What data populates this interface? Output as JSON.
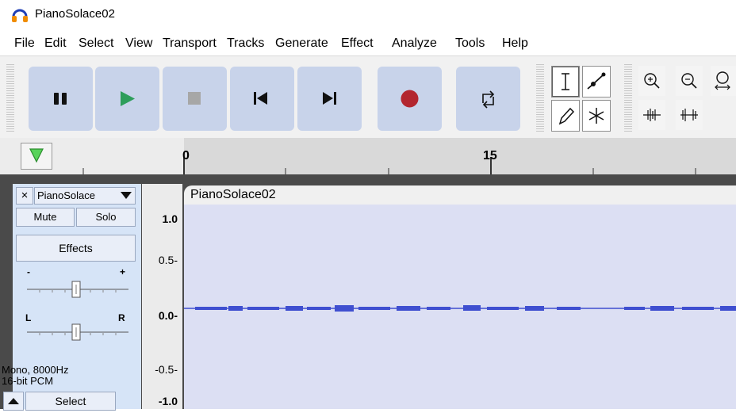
{
  "window": {
    "title": "PianoSolace02"
  },
  "menu": [
    "File",
    "Edit",
    "Select",
    "View",
    "Transport",
    "Tracks",
    "Generate",
    "Effect",
    "Analyze",
    "Tools",
    "Help"
  ],
  "ruler": {
    "ticks": [
      "0",
      "15"
    ]
  },
  "track": {
    "name": "PianoSolace",
    "close_label": "×",
    "mute_label": "Mute",
    "solo_label": "Solo",
    "effects_label": "Effects",
    "gain_minus": "-",
    "gain_plus": "+",
    "pan_left": "L",
    "pan_right": "R",
    "info_line1": "Mono, 8000Hz",
    "info_line2": "16-bit PCM",
    "select_label": "Select",
    "clip_name": "PianoSolace02"
  },
  "scale": [
    "1.0",
    "0.5-",
    "0.0-",
    "-0.5-",
    "-1.0"
  ],
  "colors": {
    "transport_btn": "#c8d3ea",
    "play": "#2e9e5b",
    "record": "#b3262f",
    "waveform": "#3f4fd0"
  }
}
